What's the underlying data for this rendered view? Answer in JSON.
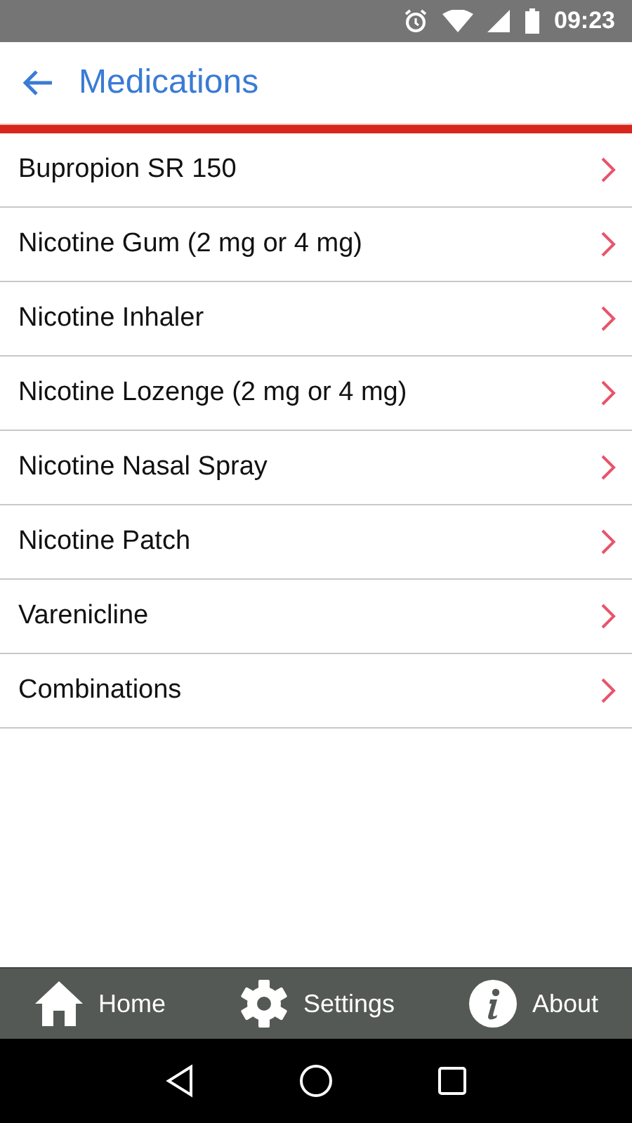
{
  "status_bar": {
    "time": "09:23"
  },
  "header": {
    "title": "Medications"
  },
  "items": [
    {
      "label": "Bupropion SR 150"
    },
    {
      "label": "Nicotine Gum (2 mg or 4 mg)"
    },
    {
      "label": "Nicotine Inhaler"
    },
    {
      "label": "Nicotine Lozenge (2 mg or 4 mg)"
    },
    {
      "label": "Nicotine Nasal Spray"
    },
    {
      "label": "Nicotine Patch"
    },
    {
      "label": "Varenicline"
    },
    {
      "label": "Combinations"
    }
  ],
  "bottom_nav": [
    {
      "kind": "home",
      "label": "Home"
    },
    {
      "kind": "settings",
      "label": "Settings"
    },
    {
      "kind": "about",
      "label": "About"
    }
  ]
}
